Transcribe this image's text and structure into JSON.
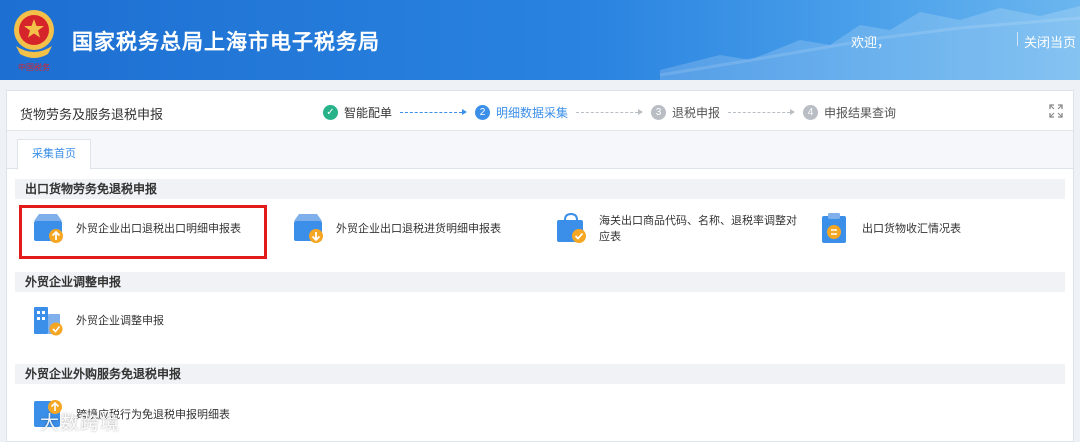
{
  "header": {
    "title": "国家税务总局上海市电子税务局",
    "welcome": "欢迎，",
    "close_page": "关闭当页",
    "emblem_caption": "中国税务"
  },
  "topbar": {
    "module_title": "货物劳务及服务退税申报",
    "steps": [
      {
        "label": "智能配单",
        "status": "done",
        "marker": "✓"
      },
      {
        "label": "明细数据采集",
        "status": "active",
        "marker": "2"
      },
      {
        "label": "退税申报",
        "status": "todo",
        "marker": "3"
      },
      {
        "label": "申报结果查询",
        "status": "todo",
        "marker": "4"
      }
    ]
  },
  "tabs": [
    {
      "label": "采集首页"
    }
  ],
  "sections": [
    {
      "title": "出口货物劳务免退税申报",
      "items": [
        {
          "label": "外贸企业出口退税出口明细申报表",
          "icon": "export-upload-icon"
        },
        {
          "label": "外贸企业出口退税进货明细申报表",
          "icon": "purchase-download-icon"
        },
        {
          "label": "海关出口商品代码、名称、退税率调整对应表",
          "icon": "customs-bag-icon"
        },
        {
          "label": "出口货物收汇情况表",
          "icon": "clipboard-icon"
        }
      ]
    },
    {
      "title": "外贸企业调整申报",
      "items": [
        {
          "label": "外贸企业调整申报",
          "icon": "building-adjust-icon"
        }
      ]
    },
    {
      "title": "外贸企业外购服务免退税申报",
      "items": [
        {
          "label": "跨境应税行为免退税申报明细表",
          "icon": "crossborder-icon"
        }
      ]
    }
  ],
  "watermark": {
    "text": "大数跨境"
  },
  "colors": {
    "header_blue": "#2a83e0",
    "accent": "#3b8fe8",
    "done_green": "#27b38a",
    "highlight_red": "#e21b1b",
    "icon_orange": "#f5a623"
  }
}
